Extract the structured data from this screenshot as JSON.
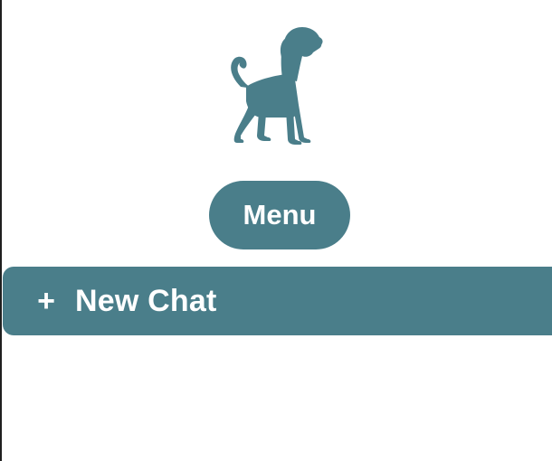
{
  "logo": {
    "icon": "dog-silhouette-icon",
    "color": "#4a7e8a"
  },
  "menu_button": {
    "label": "Menu"
  },
  "new_chat_button": {
    "icon": "plus-icon",
    "icon_glyph": "+",
    "label": "New Chat"
  },
  "colors": {
    "accent": "#4a7e8a",
    "background": "#ffffff",
    "text_on_accent": "#ffffff"
  }
}
